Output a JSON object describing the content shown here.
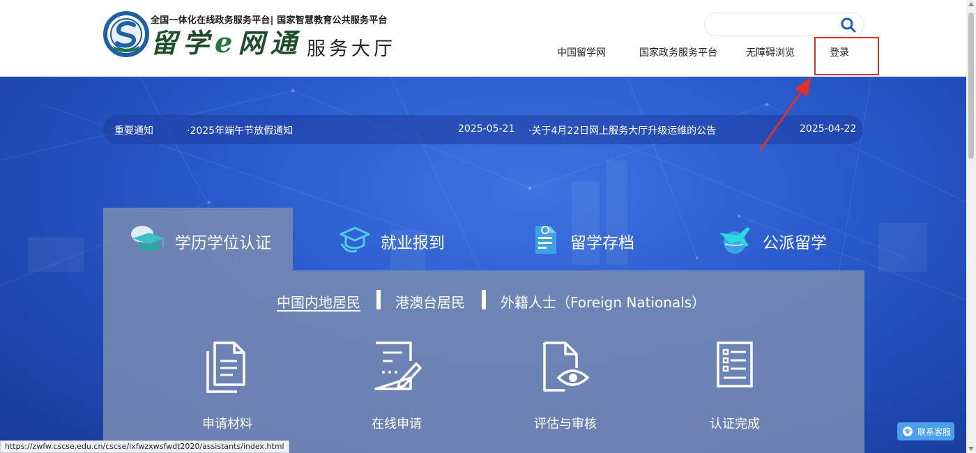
{
  "header": {
    "logo_subtitle": "全国一体化在线政务服务平台| 国家智慧教育公共服务平台",
    "logo_main_a": "留学",
    "logo_main_e": "e",
    "logo_main_b": "网通",
    "logo_hall": "服务大厅",
    "search_placeholder": "",
    "nav": [
      "中国留学网",
      "国家政务服务平台",
      "无障碍浏览",
      "登录"
    ]
  },
  "notice": {
    "label": "重要通知",
    "items": [
      {
        "title": "·2025年端午节放假通知",
        "date": "2025-05-21"
      },
      {
        "title": "·关于4月22日网上服务大厅升级运维的公告",
        "date": "2025-04-22"
      }
    ]
  },
  "tabs": [
    {
      "label": "学历学位认证",
      "icon": "graduation-cap-icon",
      "active": true
    },
    {
      "label": "就业报到",
      "icon": "mortarboard-outline-icon",
      "active": false
    },
    {
      "label": "留学存档",
      "icon": "archive-file-icon",
      "active": false
    },
    {
      "label": "公派留学",
      "icon": "airplane-globe-icon",
      "active": false
    }
  ],
  "sub_tabs": [
    {
      "label": "中国内地居民",
      "active": true
    },
    {
      "label": "港澳台居民",
      "active": false
    },
    {
      "label": "外籍人士（Foreign Nationals）",
      "active": false
    }
  ],
  "steps": [
    {
      "label": "申请材料",
      "icon": "documents-icon"
    },
    {
      "label": "在线申请",
      "icon": "form-edit-icon"
    },
    {
      "label": "评估与审核",
      "icon": "document-eye-icon"
    },
    {
      "label": "认证完成",
      "icon": "checklist-icon"
    }
  ],
  "service_button": "联系客服",
  "status_url": "https://zwfw.cscse.edu.cn/cscse/lxfwzxwsfwdt2020/assistants/index.html",
  "colors": {
    "hero_blue": "#2a5bcc",
    "panel_gray": "#788ab2",
    "highlight_red": "#e0302e",
    "logo_blue": "#1f5fa8",
    "logo_green": "#1f7a38",
    "service_blue": "#4a9ff0"
  }
}
